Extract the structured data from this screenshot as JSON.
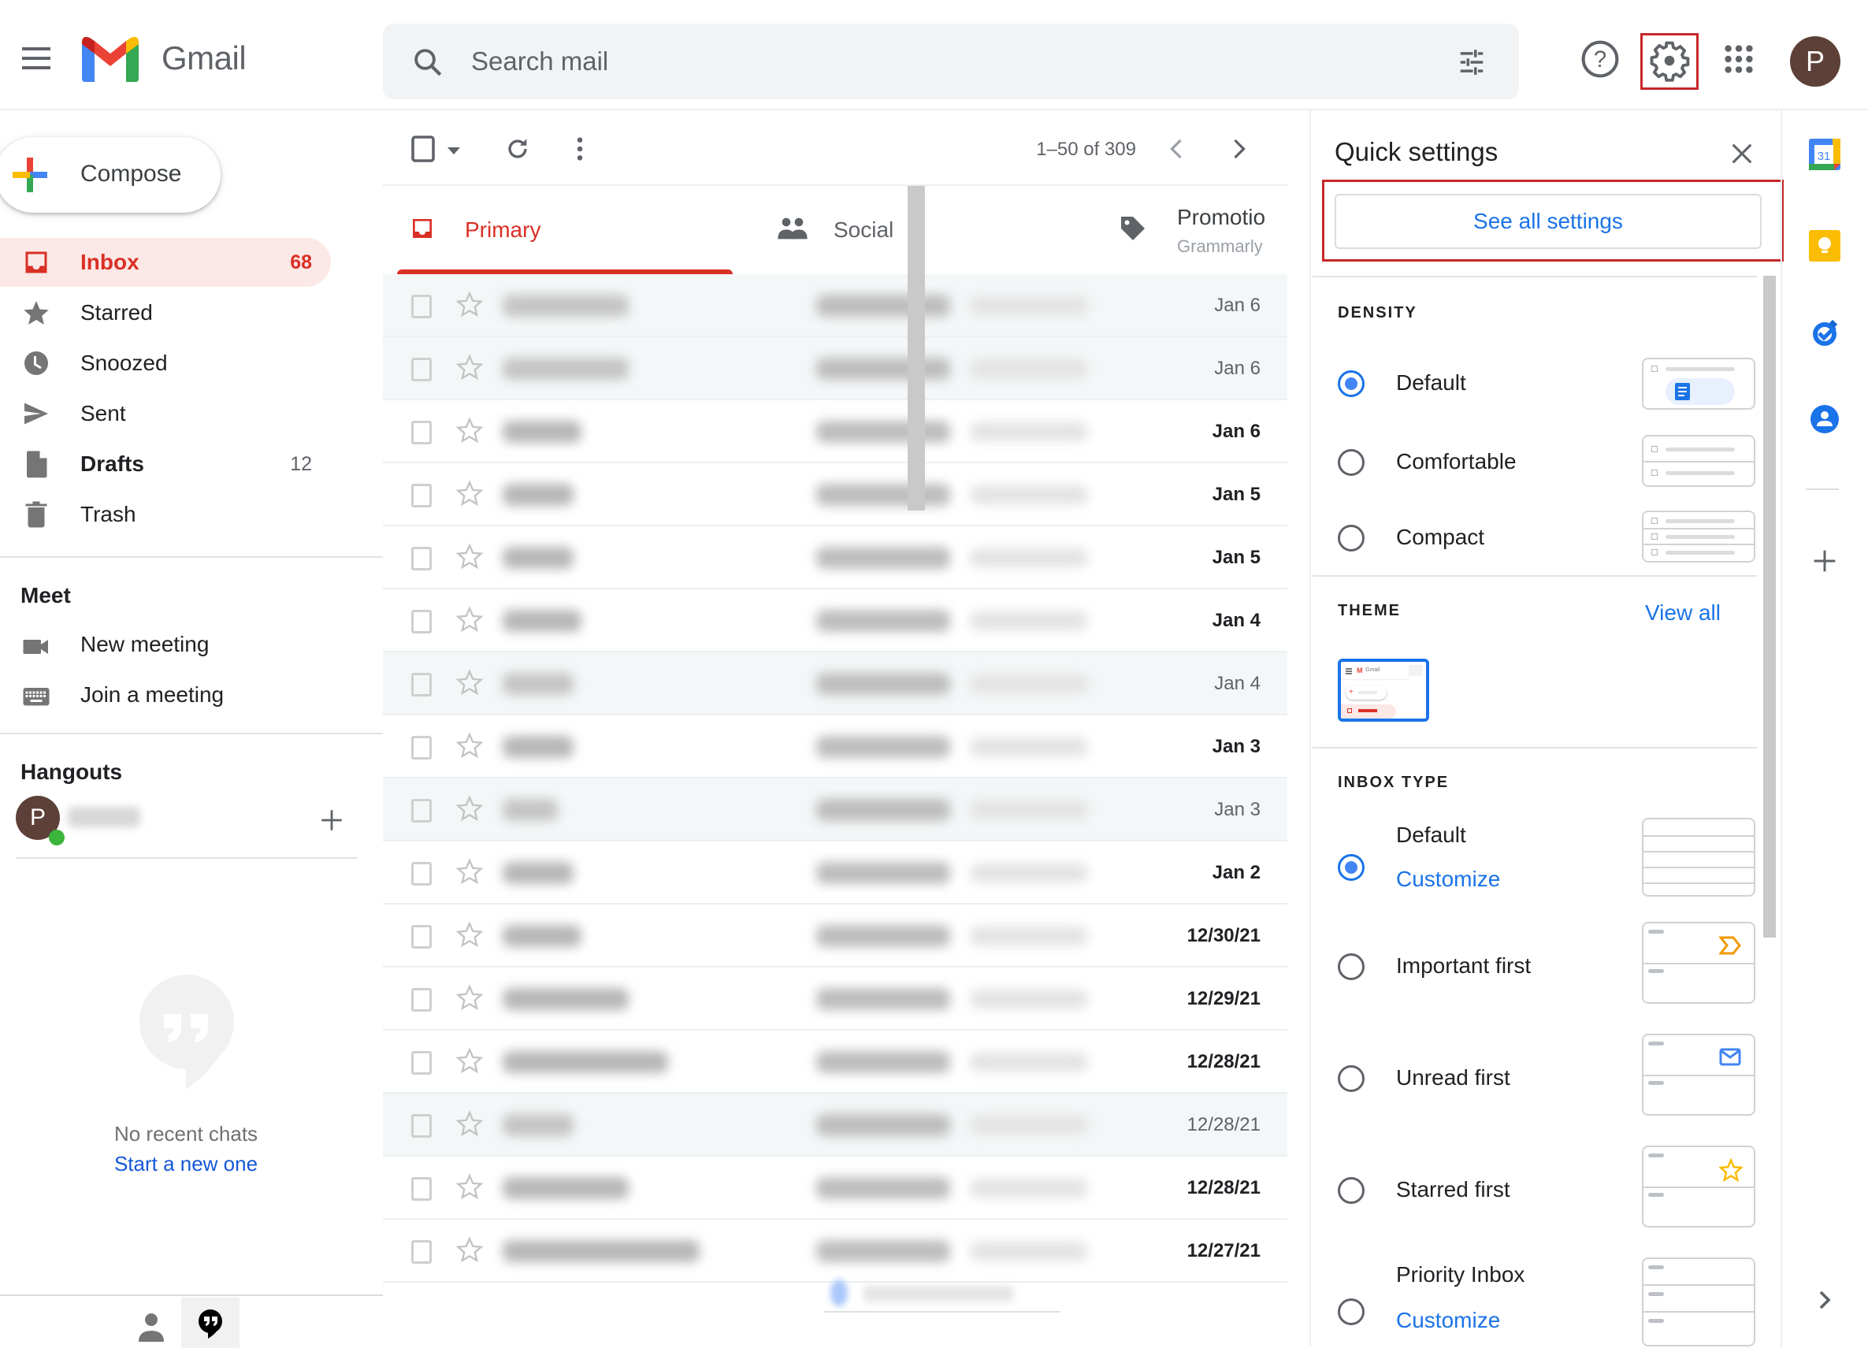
{
  "header": {
    "app_name": "Gmail",
    "search_placeholder": "Search mail",
    "avatar_initial": "P",
    "icons": [
      "menu-icon",
      "gmail-logo",
      "search-icon",
      "search-options-icon",
      "help-icon",
      "settings-icon",
      "apps-grid-icon",
      "account-avatar"
    ]
  },
  "compose": {
    "label": "Compose"
  },
  "nav": {
    "items": [
      {
        "label": "Inbox",
        "count": "68",
        "icon": "inbox-icon",
        "active": true
      },
      {
        "label": "Starred",
        "count": "",
        "icon": "star-icon"
      },
      {
        "label": "Snoozed",
        "count": "",
        "icon": "clock-icon"
      },
      {
        "label": "Sent",
        "count": "",
        "icon": "send-icon"
      },
      {
        "label": "Drafts",
        "count": "12",
        "icon": "draft-icon",
        "bold": true
      },
      {
        "label": "Trash",
        "count": "",
        "icon": "trash-icon"
      }
    ]
  },
  "meet": {
    "title": "Meet",
    "items": [
      {
        "label": "New meeting",
        "icon": "video-camera-icon"
      },
      {
        "label": "Join a meeting",
        "icon": "keyboard-icon"
      }
    ]
  },
  "hangouts": {
    "title": "Hangouts",
    "user_initial": "P",
    "empty_text": "No recent chats",
    "start_link": "Start a new one"
  },
  "toolbar": {
    "pager": "1–50 of 309"
  },
  "tabs": [
    {
      "label": "Primary",
      "sub": "",
      "active": true
    },
    {
      "label": "Social",
      "sub": ""
    },
    {
      "label": "Promotio",
      "sub": "Grammarly"
    }
  ],
  "emails": [
    {
      "date": "Jan 6",
      "unread": false,
      "sender_w": 160
    },
    {
      "date": "Jan 6",
      "unread": false,
      "sender_w": 160
    },
    {
      "date": "Jan 6",
      "unread": true,
      "sender_w": 100
    },
    {
      "date": "Jan 5",
      "unread": true,
      "sender_w": 90
    },
    {
      "date": "Jan 5",
      "unread": true,
      "sender_w": 90
    },
    {
      "date": "Jan 4",
      "unread": true,
      "sender_w": 100
    },
    {
      "date": "Jan 4",
      "unread": false,
      "sender_w": 90
    },
    {
      "date": "Jan 3",
      "unread": true,
      "sender_w": 90
    },
    {
      "date": "Jan 3",
      "unread": false,
      "sender_w": 70
    },
    {
      "date": "Jan 2",
      "unread": true,
      "sender_w": 90
    },
    {
      "date": "12/30/21",
      "unread": true,
      "sender_w": 100
    },
    {
      "date": "12/29/21",
      "unread": true,
      "sender_w": 160
    },
    {
      "date": "12/28/21",
      "unread": true,
      "sender_w": 210
    },
    {
      "date": "12/28/21",
      "unread": false,
      "sender_w": 90
    },
    {
      "date": "12/28/21",
      "unread": true,
      "sender_w": 160
    },
    {
      "date": "12/27/21",
      "unread": true,
      "sender_w": 250
    }
  ],
  "quick_settings": {
    "title": "Quick settings",
    "see_all": "See all settings",
    "density": {
      "title": "DENSITY",
      "options": [
        {
          "label": "Default",
          "selected": true
        },
        {
          "label": "Comfortable",
          "selected": false
        },
        {
          "label": "Compact",
          "selected": false
        }
      ]
    },
    "theme": {
      "title": "THEME",
      "view_all": "View all"
    },
    "inbox_type": {
      "title": "INBOX TYPE",
      "options": [
        {
          "label": "Default",
          "selected": true,
          "link": "Customize"
        },
        {
          "label": "Important first",
          "selected": false
        },
        {
          "label": "Unread first",
          "selected": false
        },
        {
          "label": "Starred first",
          "selected": false
        },
        {
          "label": "Priority Inbox",
          "selected": false,
          "link": "Customize"
        }
      ]
    }
  },
  "side_panel": {
    "calendar_day": "31",
    "icons": [
      "calendar-icon",
      "keep-icon",
      "tasks-icon",
      "contacts-icon",
      "add-addon-icon",
      "expand-panel-icon"
    ]
  },
  "colors": {
    "accent_red": "#d93025",
    "link_blue": "#1a73e8",
    "highlight_red": "#c62828",
    "avatar_brown": "#5d4037"
  }
}
